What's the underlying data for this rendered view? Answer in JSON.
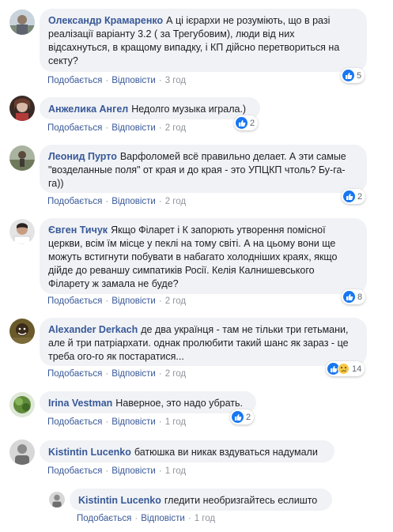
{
  "actions_labels": {
    "like": "Подобається",
    "reply": "Відповісти"
  },
  "comments": [
    {
      "author": "Олександр Крамаренко",
      "text": "А ці ієрархи не розуміють, що в разі реалізації варіанту 3.2 ( за Трегубовим), люди від них відсахнуться, в кращому випадку, і КП дійсно перетвориться на секту?",
      "time": "3 год",
      "reactions": "5",
      "reaction_types": [
        "like-icon"
      ]
    },
    {
      "author": "Анжелика Ангел",
      "text": "Недолго музыка играла.)",
      "time": "2 год",
      "reactions": "2",
      "reaction_types": [
        "like-icon"
      ]
    },
    {
      "author": "Леонид Пурто",
      "text": "Варфоломей всё правильно делает. А эти самые \"возделанные поля\" от края и до края - это УПЦКП чтоль? Бу-га-га))",
      "time": "2 год",
      "reactions": "2",
      "reaction_types": [
        "like-icon"
      ]
    },
    {
      "author": "Євген Тичук",
      "text": "Якщо Філарет і К запорють утворення помісної церкви, всім їм місце у пеклі на тому світі. А на цьому вони ще можуть встигнути побувати в набагато холодніших краях, якщо дійде до реваншу симпатиків Росії. Келія Калнишевського Філарету ж замала не буде?",
      "time": "2 год",
      "reactions": "8",
      "reaction_types": [
        "like-icon"
      ]
    },
    {
      "author": "Alexander Derkach",
      "text": "де два українця - там не тільки три гетьмани, але й три патріархати. однак пролюбити такий шанс як зараз - це треба ого-го як постаратися...",
      "time": "2 год",
      "reactions": "14",
      "reaction_types": [
        "like-icon",
        "sad-icon"
      ]
    },
    {
      "author": "Irina Vestman",
      "text": "Наверное, это надо убрать.",
      "time": "1 год",
      "reactions": "2",
      "reaction_types": [
        "like-icon"
      ]
    },
    {
      "author": "Kistintin Lucenko",
      "text": "батюшка ви никак вздуваться надумали",
      "time": "1 год",
      "reactions": "",
      "reaction_types": []
    },
    {
      "author": "Kistintin Lucenko",
      "text": "гледити необризгайтесь еслишто",
      "time": "1 год",
      "reactions": "",
      "reaction_types": [],
      "is_reply": true
    }
  ]
}
